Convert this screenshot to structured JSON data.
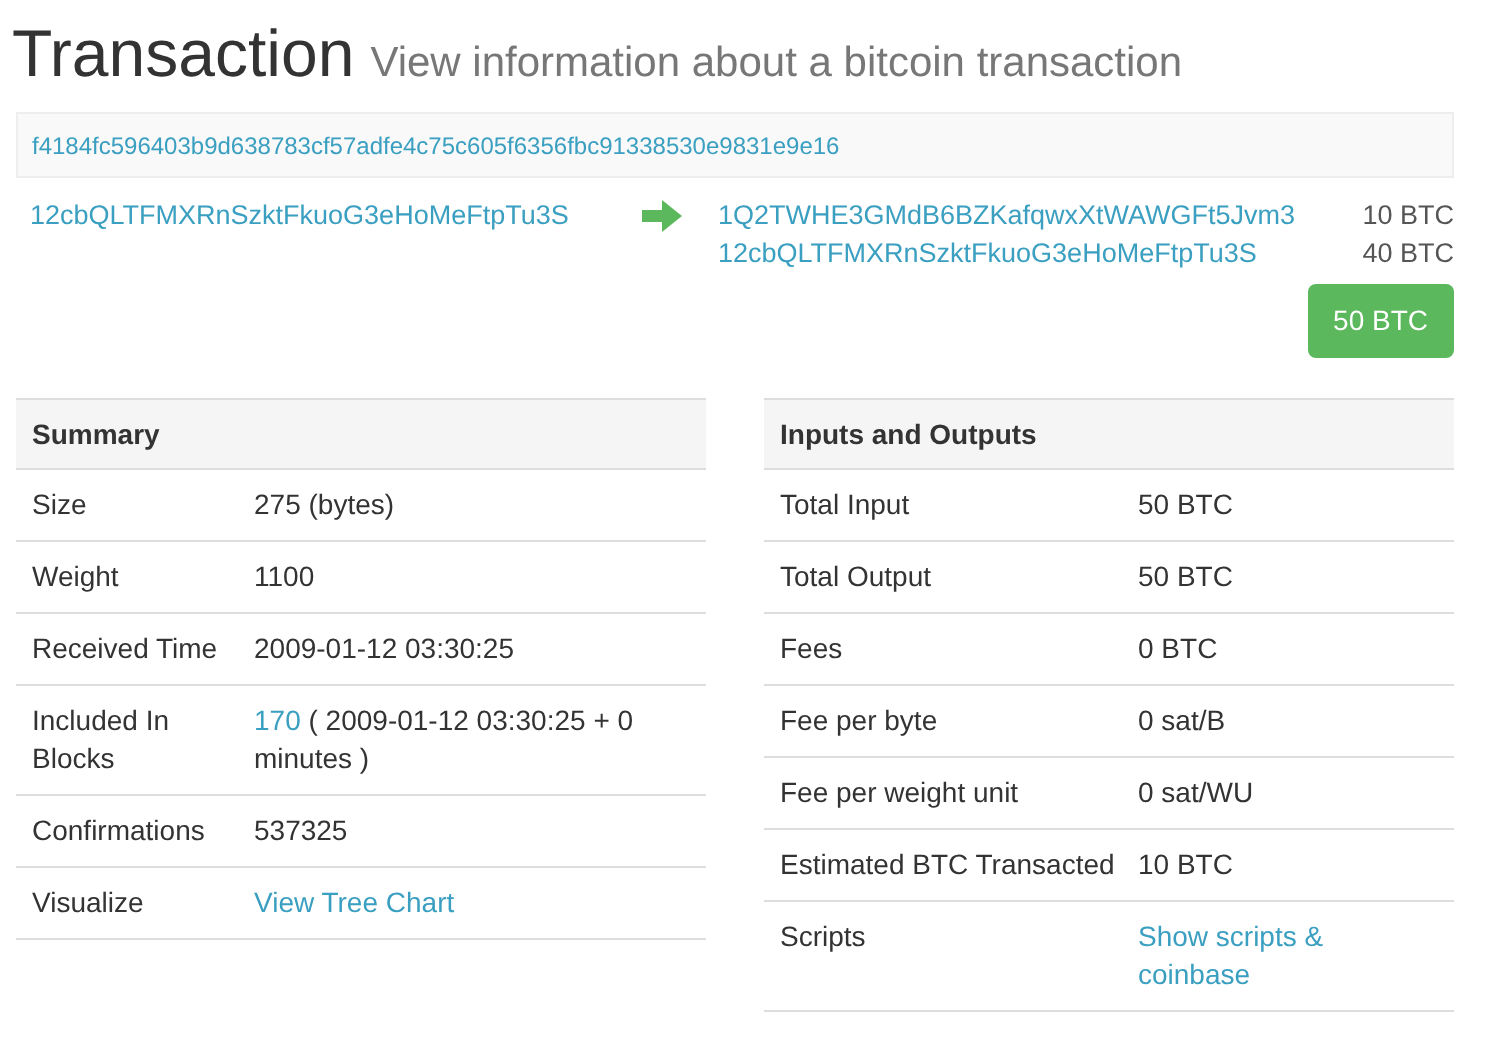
{
  "header": {
    "title": "Transaction",
    "subtitle": "View information about a bitcoin transaction"
  },
  "transaction": {
    "hash": "f4184fc596403b9d638783cf57adfe4c75c605f6356fbc91338530e9831e9e16",
    "inputs": [
      {
        "address": "12cbQLTFMXRnSzktFkuoG3eHoMeFtpTu3S"
      }
    ],
    "outputs": [
      {
        "address": "1Q2TWHE3GMdB6BZKafqwxXtWAWGFt5Jvm3",
        "amount": "10 BTC"
      },
      {
        "address": "12cbQLTFMXRnSzktFkuoG3eHoMeFtpTu3S",
        "amount": "40 BTC"
      }
    ],
    "total": "50 BTC"
  },
  "tables": [
    {
      "title": "Summary",
      "rows": [
        {
          "label": "Size",
          "parts": [
            {
              "kind": "text",
              "text": "275 (bytes)"
            }
          ]
        },
        {
          "label": "Weight",
          "parts": [
            {
              "kind": "text",
              "text": "1100"
            }
          ]
        },
        {
          "label": "Received Time",
          "parts": [
            {
              "kind": "text",
              "text": "2009-01-12 03:30:25"
            }
          ]
        },
        {
          "label": "Included In Blocks",
          "parts": [
            {
              "kind": "link",
              "text": "170"
            },
            {
              "kind": "text",
              "text": " ( 2009-01-12 03:30:25 + 0 minutes )"
            }
          ]
        },
        {
          "label": "Confirmations",
          "parts": [
            {
              "kind": "text",
              "text": "537325"
            }
          ]
        },
        {
          "label": "Visualize",
          "parts": [
            {
              "kind": "link",
              "text": "View Tree Chart"
            }
          ]
        }
      ]
    },
    {
      "title": "Inputs and Outputs",
      "rows": [
        {
          "label": "Total Input",
          "parts": [
            {
              "kind": "text",
              "text": "50 BTC"
            }
          ]
        },
        {
          "label": "Total Output",
          "parts": [
            {
              "kind": "text",
              "text": "50 BTC"
            }
          ]
        },
        {
          "label": "Fees",
          "parts": [
            {
              "kind": "text",
              "text": "0 BTC"
            }
          ]
        },
        {
          "label": "Fee per byte",
          "parts": [
            {
              "kind": "text",
              "text": "0 sat/B"
            }
          ]
        },
        {
          "label": "Fee per weight unit",
          "parts": [
            {
              "kind": "text",
              "text": "0 sat/WU"
            }
          ]
        },
        {
          "label": "Estimated BTC Transacted",
          "parts": [
            {
              "kind": "text",
              "text": "10 BTC"
            }
          ]
        },
        {
          "label": "Scripts",
          "parts": [
            {
              "kind": "link",
              "text": "Show scripts & coinbase"
            }
          ]
        }
      ]
    }
  ]
}
